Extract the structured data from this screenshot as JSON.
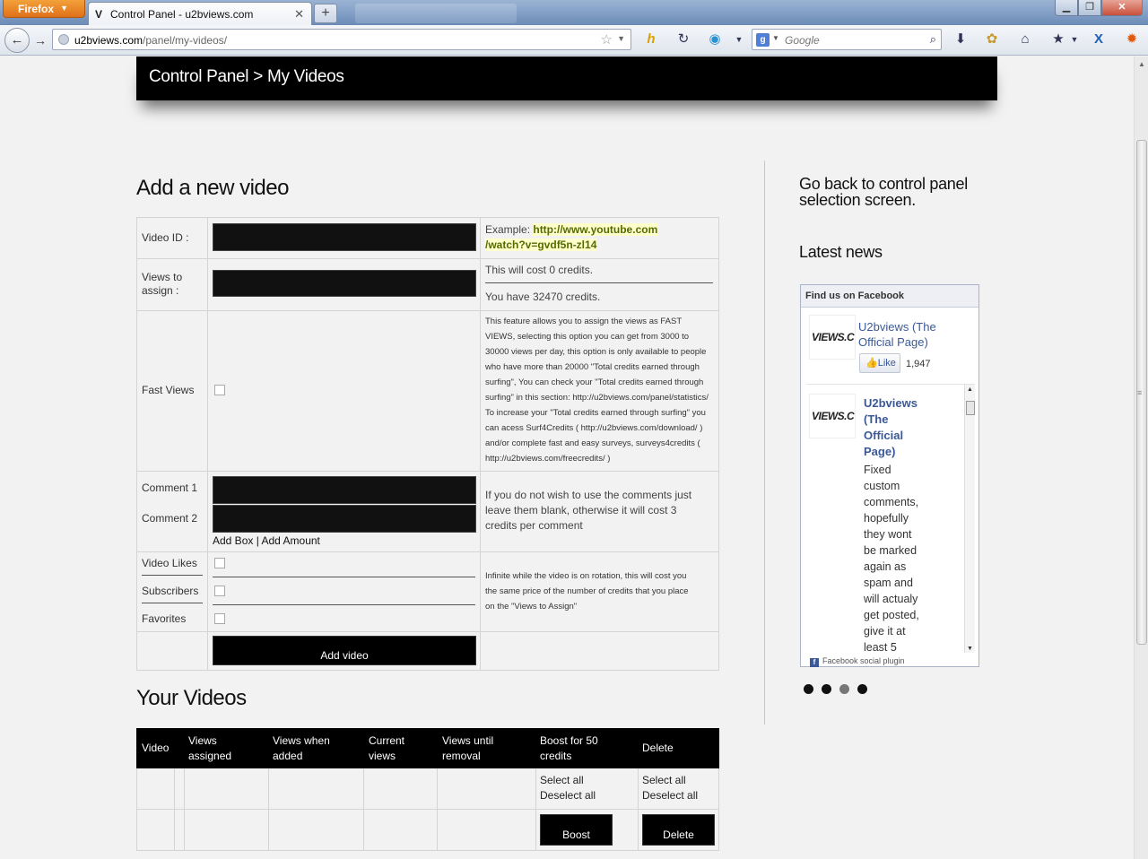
{
  "browser": {
    "menu_button": "Firefox",
    "tab_title": "Control Panel - u2bviews.com",
    "tab_favicon": "V",
    "new_tab_symbol": "+",
    "url_host": "u2bviews.com",
    "url_path": "/panel/my-videos/",
    "search_placeholder": "Google",
    "search_engine_letter": "g"
  },
  "header": {
    "title": "Control Panel > My Videos"
  },
  "add_video": {
    "heading": "Add a new video",
    "video_id_label": "Video ID :",
    "example_prefix": "Example: ",
    "example_link_line1": "http://www.youtube.com",
    "example_link_line2": "/watch?v=gvdf5n-zl14",
    "views_label_line1": "Views to",
    "views_label_line2": "assign :",
    "cost_text": "This will cost 0 credits.",
    "credits_text": "You have 32470 credits.",
    "fast_views_label": "Fast Views",
    "fast_views_note": [
      "This feature allows you to assign the views as FAST",
      "VIEWS, selecting this option you can get from 3000 to",
      "30000 views per day, this option is only available to people",
      "who have more than 20000 \"Total credits earned through",
      "surfing\", You can check your \"Total credits earned through",
      "surfing\" in this section: http://u2bviews.com/panel/statistics/",
      "To increase your \"Total credits earned through surfing\" you",
      "can acess Surf4Credits ( http://u2bviews.com/download/ )",
      "and/or complete fast and easy surveys, surveys4credits (",
      "http://u2bviews.com/freecredits/ )"
    ],
    "comment1_label": "Comment 1",
    "comment2_label": "Comment 2",
    "add_box_link": "Add Box",
    "link_separator": " | ",
    "add_amount_link": "Add Amount",
    "comments_note": [
      "If you do not wish to use the comments just",
      "leave them blank, otherwise it will cost 3",
      "credits per comment"
    ],
    "likes_label": "Video Likes",
    "subscribers_label": "Subscribers",
    "favorites_label": "Favorites",
    "infinite_note": [
      "Infinite while the video is on rotation, this will cost you",
      "the same price of the number of credits that you place",
      "on the \"Views to Assign\""
    ],
    "submit_label": "Add video"
  },
  "your_videos": {
    "heading": "Your Videos",
    "columns": [
      {
        "line1": "Video",
        "line2": ""
      },
      {
        "line1": "Views",
        "line2": "assigned"
      },
      {
        "line1": "Views when",
        "line2": "added"
      },
      {
        "line1": "Current",
        "line2": "views"
      },
      {
        "line1": "Views until",
        "line2": "removal"
      },
      {
        "line1": "Boost for 50",
        "line2": "credits"
      },
      {
        "line1": "Delete",
        "line2": ""
      }
    ],
    "select_all": "Select all",
    "deselect_all": "Deselect all",
    "boost_button": "Boost",
    "delete_button": "Delete"
  },
  "sidebar": {
    "go_back_line1": "Go back to control panel",
    "go_back_line2": "selection screen.",
    "latest_news": "Latest news",
    "facebook": {
      "header": "Find us on Facebook",
      "logo_text": "VIEWS.C",
      "page_name": "U2bviews (The Official Page)",
      "like_button": "Like",
      "like_count": "1,947",
      "post_author": [
        "U2bviews",
        "(The",
        "Official",
        "Page)"
      ],
      "post_text": [
        "Fixed",
        "custom",
        "comments,",
        "hopefully",
        "they wont",
        "be marked",
        "again as",
        "spam and",
        "will actualy",
        "get posted,",
        "give it at",
        "least 5"
      ],
      "footer": "Facebook social plugin",
      "footer_icon": "f"
    },
    "slides": {
      "count": 4,
      "active": 2
    }
  },
  "colors": {
    "header_bg": "#000000",
    "fb_blue": "#3b5998",
    "link_highlight": "#ffffcc"
  }
}
